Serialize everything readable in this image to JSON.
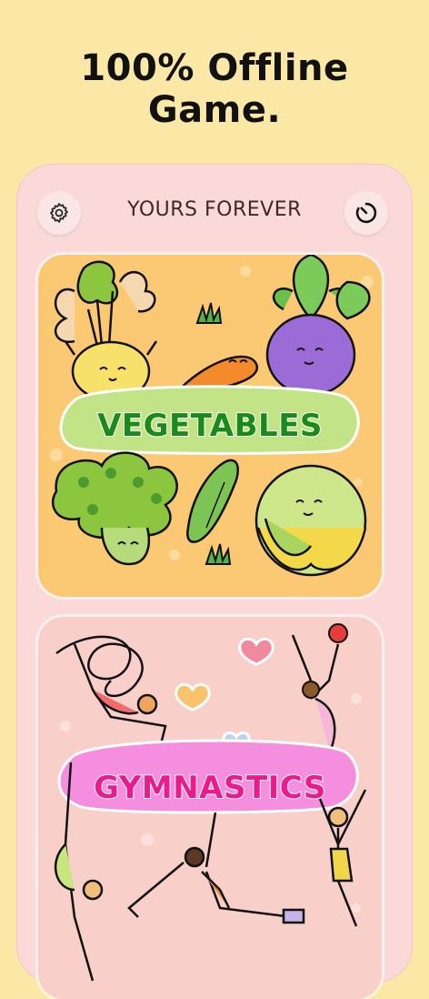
{
  "headline": {
    "line1": "100% Offline",
    "line2": "Game."
  },
  "topbar": {
    "title": "YOURS FOREVER",
    "left_icon": "gear-icon",
    "right_icon": "timer-icon"
  },
  "cards": [
    {
      "label": "VEGETABLES",
      "color": "#1a8a1a",
      "background": "#fbc874"
    },
    {
      "label": "GYMNASTICS",
      "color": "#ec1b8b",
      "background": "#f8d0c9"
    }
  ]
}
